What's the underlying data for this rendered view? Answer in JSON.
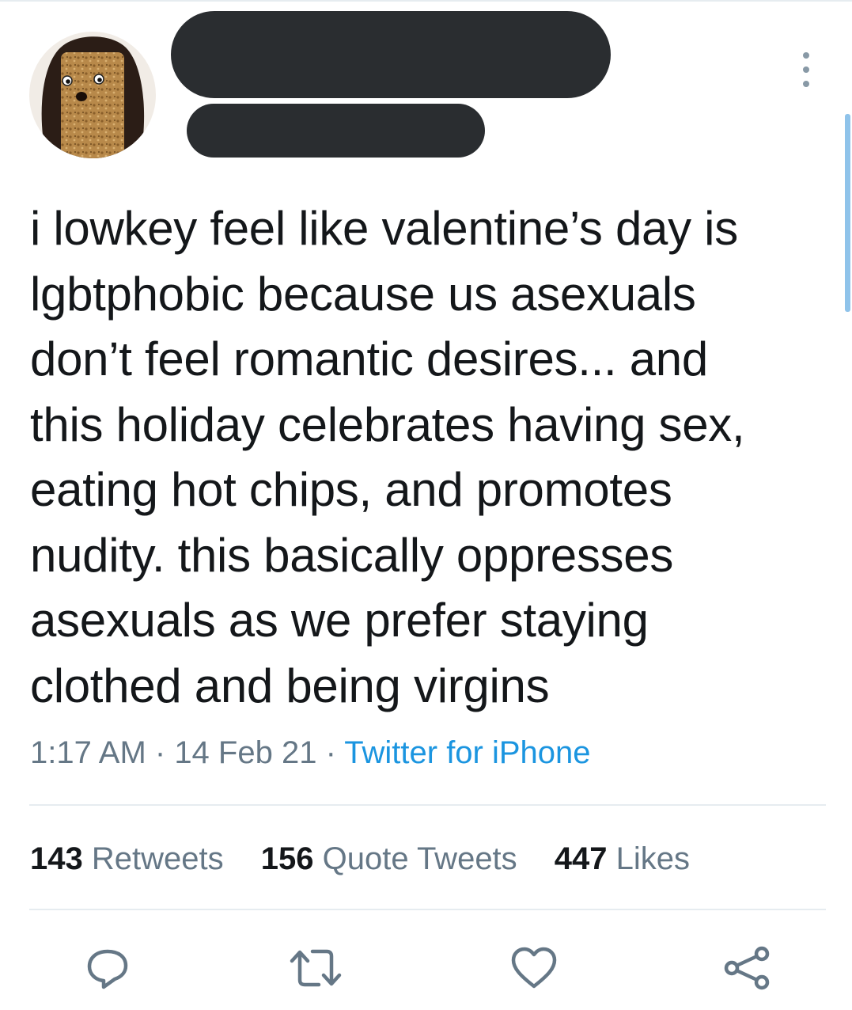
{
  "tweet": {
    "text": "i lowkey feel like valentine’s day is\nlgbtphobic because us asexuals\ndon’t feel romantic desires... and\nthis holiday celebrates having sex,\neating hot chips, and promotes\nnudity. this basically oppresses\nasexuals as we prefer staying\nclothed and being virgins",
    "time": "1:17 AM",
    "separator": " · ",
    "date": "14 Feb 21",
    "source": "Twitter for iPhone"
  },
  "stats": {
    "retweets_count": "143",
    "retweets_label": " Retweets",
    "quotes_count": "156",
    "quotes_label": " Quote Tweets",
    "likes_count": "447",
    "likes_label": " Likes"
  },
  "icons": {
    "reply": "reply-icon",
    "retweet": "retweet-icon",
    "like": "heart-icon",
    "share": "share-icon",
    "more": "more-vertical-icon"
  },
  "colors": {
    "link": "#1b95e0",
    "secondary_text": "#657786",
    "redaction": "#2a2d30"
  }
}
